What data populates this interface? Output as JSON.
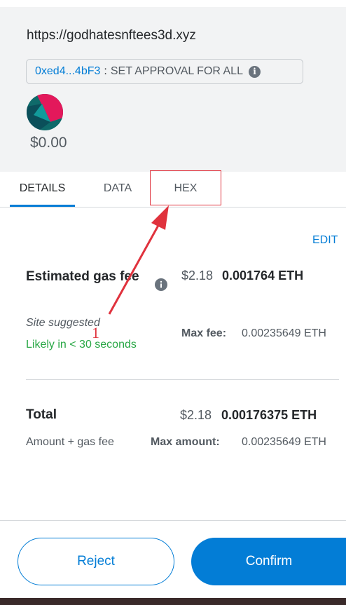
{
  "site": {
    "origin": "https://godhatesnftees3d.xyz"
  },
  "approval": {
    "address": "0xed4...4bF3",
    "separator": ":",
    "method": "SET APPROVAL FOR ALL"
  },
  "asset": {
    "value": "$0.00"
  },
  "tabs": [
    {
      "label": "DETAILS",
      "active": true
    },
    {
      "label": "DATA",
      "active": false
    },
    {
      "label": "HEX",
      "active": false
    }
  ],
  "details": {
    "edit_label": "EDIT",
    "gas": {
      "label": "Estimated gas fee",
      "usd": "$2.18",
      "eth": "0.001764 ETH",
      "site_suggested": "Site suggested",
      "likely": "Likely in < 30 seconds",
      "max_fee_label": "Max fee:",
      "max_fee_value": "0.00235649 ETH"
    },
    "total": {
      "label": "Total",
      "usd": "$2.18",
      "eth": "0.00176375 ETH",
      "sublabel": "Amount + gas fee",
      "max_amount_label": "Max amount:",
      "max_amount_value": "0.00235649 ETH"
    }
  },
  "footer": {
    "reject_label": "Reject",
    "confirm_label": "Confirm"
  },
  "annotation": {
    "number": "1"
  },
  "colors": {
    "accent": "#037dd6",
    "success": "#28a745",
    "annotation": "#e0323d"
  }
}
